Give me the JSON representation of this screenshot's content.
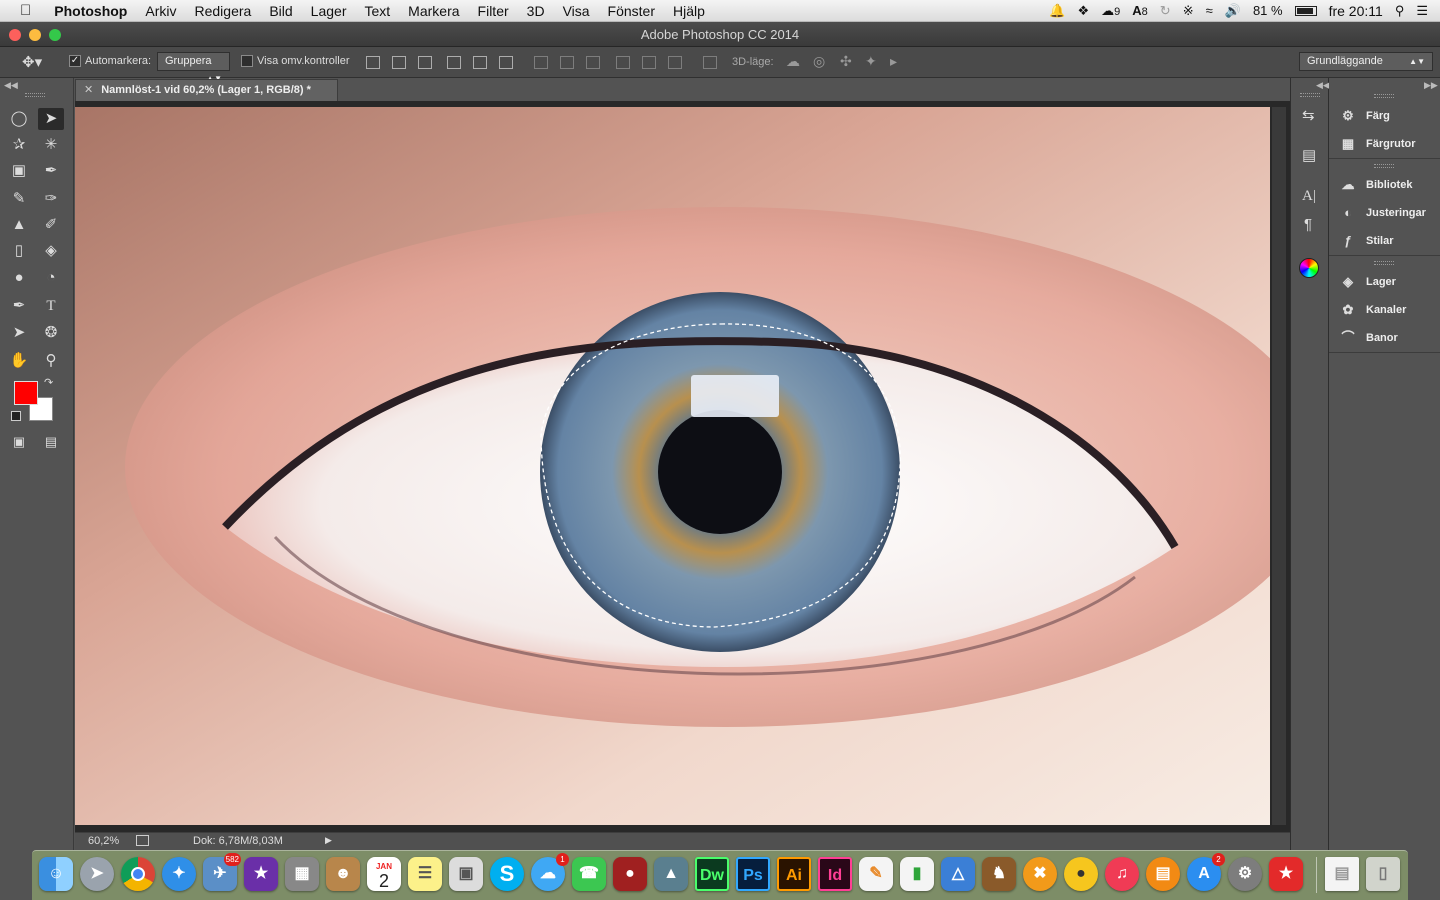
{
  "menubar": {
    "app_name": "Photoshop",
    "items": [
      "Arkiv",
      "Redigera",
      "Bild",
      "Lager",
      "Text",
      "Markera",
      "Filter",
      "3D",
      "Visa",
      "Fönster",
      "Hjälp"
    ],
    "cc_badge": "9",
    "adobe_badge": "8",
    "battery": "81 %",
    "clock": "fre 20:11"
  },
  "window": {
    "title": "Adobe Photoshop CC 2014"
  },
  "options": {
    "auto_select_label": "Automarkera:",
    "auto_select_target": "Gruppera",
    "show_transform_label": "Visa omv.kontroller",
    "mode_3d_label": "3D-läge:",
    "workspace": "Grundläggande"
  },
  "document": {
    "tab_title": "Namnlöst-1 vid 60,2% (Lager 1, RGB/8) *",
    "zoom": "60,2%",
    "doc_info": "Dok: 6,78M/8,03M"
  },
  "colors": {
    "foreground": "#ff0000",
    "background": "#ffffff"
  },
  "panels": {
    "items": [
      "Färg",
      "Färgrutor",
      "Bibliotek",
      "Justeringar",
      "Stilar",
      "Lager",
      "Kanaler",
      "Banor"
    ]
  },
  "dock": {
    "photos_badge": "582",
    "calendar_month": "JAN",
    "calendar_day": "2",
    "messages_badge": "1",
    "appstore_badge": "2",
    "skype_label": "S",
    "dw_label": "Dw",
    "ps_label": "Ps",
    "ai_label": "Ai",
    "id_label": "Id"
  }
}
